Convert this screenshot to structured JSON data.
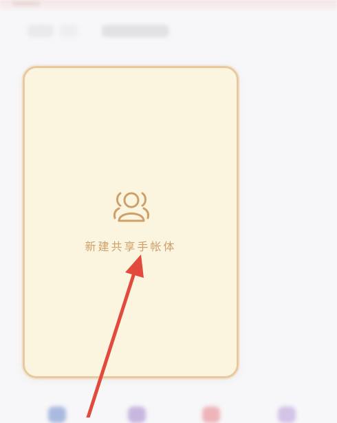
{
  "card": {
    "label": "新建共享手帐体",
    "icon": "users-group-icon"
  },
  "colors": {
    "card_fill": "#fbf5df",
    "card_border": "#e8c99f",
    "accent": "#cf9f6a",
    "arrow": "#e14a3c"
  },
  "dock": {
    "icons": [
      "blue-app-icon",
      "purple-app-icon",
      "pink-app-icon",
      "violet-app-icon"
    ]
  }
}
